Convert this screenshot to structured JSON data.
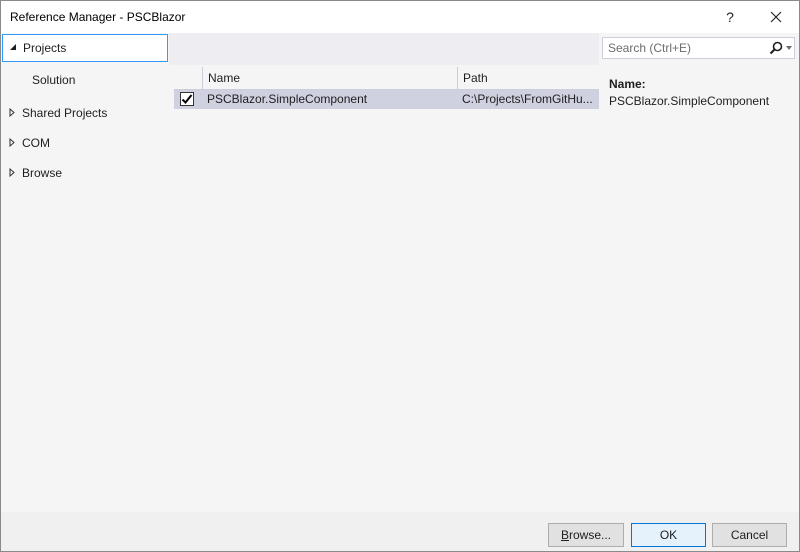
{
  "window": {
    "title": "Reference Manager - PSCBlazor",
    "help_label": "?",
    "close_label": "✕"
  },
  "nav": {
    "items": [
      {
        "label": "Projects",
        "arrow": "◢",
        "state": "expanded",
        "selected": true
      },
      {
        "label": "Solution",
        "sub": true
      },
      {
        "label": "Shared Projects",
        "arrow": "▷",
        "state": "collapsed"
      },
      {
        "label": "COM",
        "arrow": "▷",
        "state": "collapsed"
      },
      {
        "label": "Browse",
        "arrow": "▷",
        "state": "collapsed"
      }
    ]
  },
  "grid": {
    "columns": [
      "Name",
      "Path"
    ],
    "rows": [
      {
        "checked": true,
        "name": "PSCBlazor.SimpleComponent",
        "path": "C:\\Projects\\FromGitHu..."
      }
    ]
  },
  "search": {
    "placeholder": "Search (Ctrl+E)",
    "value": "",
    "icon": "search-icon"
  },
  "details": {
    "label": "Name:",
    "value": "PSCBlazor.SimpleComponent"
  },
  "footer": {
    "browse_label": "Browse...",
    "browse_mnemonic": "B",
    "browse_rest": "rowse...",
    "ok_label": "OK",
    "cancel_label": "Cancel"
  },
  "colors": {
    "accent": "#3399ff",
    "selected_row": "#cfd1e0",
    "panel_bg": "#f5f5f5",
    "ok_border": "#0078d7"
  }
}
